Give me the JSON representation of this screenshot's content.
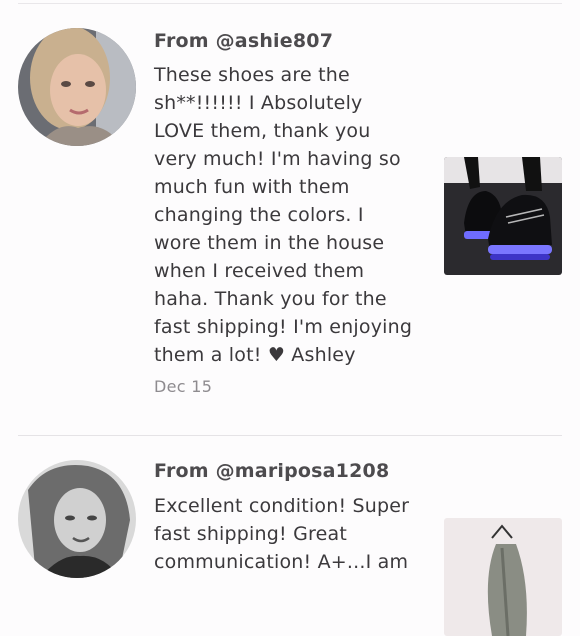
{
  "reviews": [
    {
      "from": "From @ashie807",
      "comment": "These shoes are the sh**!!!!!! I Absolutely LOVE them, thank you very much! I'm having so much fun with them changing the colors. I wore them in the house when I received them haha. Thank you for the fast shipping! I'm enjoying them a lot! ♥ Ashley",
      "date": "Dec 15"
    },
    {
      "from": "From @mariposa1208",
      "comment": "Excellent condition! Super fast shipping! Great communication! A+...I am",
      "date": ""
    }
  ]
}
